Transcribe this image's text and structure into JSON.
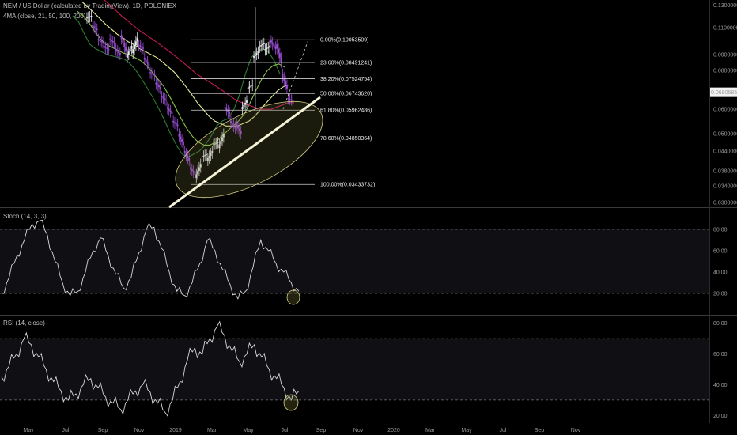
{
  "header": {
    "symbol_line": "NEM / US Dollar (calculated by TradingView), 1D, POLONIEX",
    "ma_line": "4MA (close, 21, 50, 100, 200)"
  },
  "panes": {
    "stoch_title": "Stoch (14, 3, 3)",
    "rsi_title": "RSI (14, close)"
  },
  "chart_data": [
    {
      "type": "line",
      "pane": "price",
      "title": "NEM / US Dollar (calculated by TradingView), 1D, POLONIEX",
      "y_scale": "log",
      "ylim": [
        0.029,
        0.135
      ],
      "y_ticks": [
        "0.13000000",
        "0.11000000",
        "0.09000000",
        "0.08000000",
        "0.06000000",
        "0.05000000",
        "0.04400000",
        "0.03800000",
        "0.03400000",
        "0.03000000"
      ],
      "y_tick_values": [
        0.13,
        0.11,
        0.09,
        0.08,
        0.06,
        0.05,
        0.044,
        0.038,
        0.034,
        0.03
      ],
      "last_price_label": "0.06806857",
      "last_price": 0.06806857,
      "x_ticks": [
        "May",
        "Jul",
        "Sep",
        "Nov",
        "2019",
        "Mar",
        "May",
        "Jul",
        "Sep",
        "Nov",
        "2020",
        "Mar",
        "May",
        "Jul",
        "Sep",
        "Nov"
      ],
      "fib_levels": [
        {
          "label": "0.00%(0.10053509)",
          "value": 0.10053509
        },
        {
          "label": "23.60%(0.08491241)",
          "value": 0.08491241
        },
        {
          "label": "38.20%(0.07524754)",
          "value": 0.07524754
        },
        {
          "label": "50.00%(0.06743620)",
          "value": 0.0674362
        },
        {
          "label": "61.80%(0.05962486)",
          "value": 0.05962486
        },
        {
          "label": "78.60%(0.04850364)",
          "value": 0.04850364
        },
        {
          "label": "100.00%(0.03433732)",
          "value": 0.03433732
        }
      ],
      "price_path": [
        [
          0.125,
          0.118
        ],
        [
          0.12,
          0.112
        ],
        [
          0.108,
          0.101
        ],
        [
          0.098,
          0.096
        ],
        [
          0.093,
          0.101
        ],
        [
          0.098,
          0.094
        ],
        [
          0.09,
          0.104
        ],
        [
          0.092,
          0.088
        ],
        [
          0.096,
          0.091
        ],
        [
          0.102,
          0.097
        ],
        [
          0.094,
          0.088
        ],
        [
          0.083,
          0.079
        ],
        [
          0.077,
          0.073
        ],
        [
          0.07,
          0.066
        ],
        [
          0.064,
          0.061
        ],
        [
          0.058,
          0.055
        ],
        [
          0.053,
          0.05
        ],
        [
          0.046,
          0.044
        ],
        [
          0.041,
          0.039
        ],
        [
          0.037,
          0.036
        ],
        [
          0.04,
          0.042
        ],
        [
          0.043,
          0.041
        ],
        [
          0.044,
          0.046
        ],
        [
          0.047,
          0.045
        ],
        [
          0.05,
          0.061
        ],
        [
          0.058,
          0.055
        ],
        [
          0.052,
          0.054
        ],
        [
          0.05,
          0.06
        ],
        [
          0.064,
          0.07
        ],
        [
          0.072,
          0.088
        ],
        [
          0.092,
          0.095
        ],
        [
          0.098,
          0.093
        ],
        [
          0.096,
          0.1
        ],
        [
          0.094,
          0.097
        ],
        [
          0.085,
          0.078
        ],
        [
          0.07,
          0.065
        ],
        [
          0.064
        ]
      ],
      "ma_colors": [
        "#2e7d32",
        "#8bc34a",
        "#e6ee9c",
        "#c2185b"
      ],
      "series": [
        {
          "values": [
            0.12,
            0.115,
            0.105,
            0.097,
            0.094,
            0.092,
            0.09,
            0.089,
            0.088,
            0.087,
            0.084,
            0.08,
            0.075,
            0.07,
            0.065,
            0.06,
            0.055,
            0.05,
            0.046,
            0.043,
            0.042,
            0.043,
            0.044,
            0.046,
            0.049,
            0.053,
            0.055,
            0.056,
            0.06,
            0.067,
            0.078,
            0.088,
            0.092,
            0.094,
            0.092,
            0.086,
            0.078
          ]
        },
        {
          "values": [
            0.124,
            0.12,
            0.114,
            0.107,
            0.101,
            0.097,
            0.095,
            0.093,
            0.091,
            0.09,
            0.088,
            0.086,
            0.083,
            0.079,
            0.075,
            0.071,
            0.066,
            0.061,
            0.056,
            0.052,
            0.049,
            0.047,
            0.046,
            0.046,
            0.047,
            0.049,
            0.051,
            0.053,
            0.055,
            0.058,
            0.063,
            0.069,
            0.075,
            0.08,
            0.083,
            0.084,
            0.082
          ]
        },
        {
          "values": [
            0.133,
            0.128,
            0.123,
            0.118,
            0.113,
            0.109,
            0.105,
            0.102,
            0.099,
            0.097,
            0.094,
            0.092,
            0.09,
            0.088,
            0.085,
            0.082,
            0.079,
            0.075,
            0.071,
            0.067,
            0.063,
            0.06,
            0.057,
            0.055,
            0.054,
            0.053,
            0.053,
            0.053,
            0.054,
            0.055,
            0.057,
            0.06,
            0.063,
            0.066,
            0.069,
            0.071,
            0.072
          ]
        },
        {
          "values": [
            0.15,
            0.145,
            0.14,
            0.135,
            0.13,
            0.125,
            0.12,
            0.116,
            0.112,
            0.108,
            0.105,
            0.102,
            0.099,
            0.096,
            0.093,
            0.09,
            0.087,
            0.084,
            0.081,
            0.078,
            0.076,
            0.074,
            0.072,
            0.07,
            0.068,
            0.066,
            0.064,
            0.063,
            0.062,
            0.061,
            0.06,
            0.06,
            0.06,
            0.061,
            0.062,
            0.063,
            0.063
          ]
        }
      ],
      "trendline": {
        "from": [
          0.029,
          0.029
        ],
        "to": [
          0.068,
          0.068
        ]
      }
    },
    {
      "type": "line",
      "pane": "stoch",
      "title": "Stoch (14, 3, 3)",
      "ylim": [
        0,
        100
      ],
      "y_ticks": [
        "80.00",
        "60.00",
        "40.00",
        "20.00"
      ],
      "y_tick_values": [
        80,
        60,
        40,
        20
      ],
      "band": [
        20,
        80
      ],
      "series": [
        {
          "name": "",
          "values": [
            20,
            35,
            55,
            70,
            85,
            88,
            75,
            50,
            30,
            18,
            22,
            40,
            60,
            72,
            55,
            38,
            25,
            35,
            58,
            80,
            82,
            62,
            40,
            22,
            18,
            30,
            48,
            70,
            60,
            42,
            28,
            15,
            22,
            45,
            70,
            60,
            48,
            40,
            30,
            22
          ]
        }
      ]
    },
    {
      "type": "line",
      "pane": "rsi",
      "title": "RSI (14, close)",
      "ylim": [
        15,
        85
      ],
      "y_ticks": [
        "80.00",
        "60.00",
        "40.00",
        "20.00"
      ],
      "y_tick_values": [
        80,
        60,
        40,
        20
      ],
      "band": [
        30,
        70
      ],
      "series": [
        {
          "name": "",
          "values": [
            45,
            52,
            60,
            70,
            66,
            58,
            50,
            42,
            36,
            30,
            34,
            40,
            44,
            38,
            32,
            28,
            24,
            30,
            36,
            40,
            35,
            28,
            22,
            30,
            42,
            56,
            64,
            60,
            70,
            78,
            72,
            62,
            55,
            60,
            66,
            58,
            50,
            44,
            38,
            30,
            36
          ]
        }
      ]
    }
  ]
}
